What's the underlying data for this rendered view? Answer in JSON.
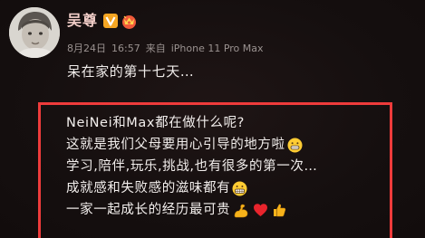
{
  "post": {
    "author": {
      "name": "吴尊",
      "badges": [
        "verified-v-icon",
        "vip-crown-icon"
      ],
      "avatar": "avatar-photo-icon"
    },
    "date": "8月24日",
    "time": "16:57",
    "source_prefix": "来自",
    "source": "iPhone 11 Pro Max",
    "text": "呆在家的第十七天…",
    "quote": {
      "border_color": "#ee3b3b",
      "lines": [
        {
          "text": "NeiNei和Max都在做什么呢?",
          "emoji": []
        },
        {
          "text": "这就是我们父母要用心引导的地方啦",
          "emoji": [
            "grinning-face-icon"
          ]
        },
        {
          "text": "学习,陪伴,玩乐,挑战,也有很多的第一次…",
          "emoji": []
        },
        {
          "text": "成就感和失败感的滋味都有",
          "emoji": [
            "grimacing-face-icon"
          ]
        },
        {
          "text": "一家一起成长的经历最可贵",
          "emoji": [
            "flexed-biceps-icon",
            "red-heart-icon",
            "thumbs-up-icon"
          ]
        }
      ]
    }
  },
  "colors": {
    "background": "#140e0e",
    "name": "#f3cfc9",
    "meta": "#9a9290",
    "text": "#f0ecea",
    "accent_red": "#ee3b3b"
  }
}
